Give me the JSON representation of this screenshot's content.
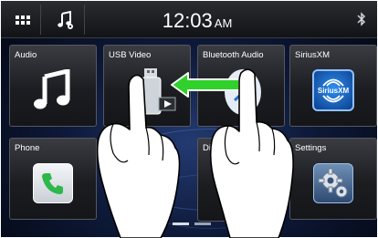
{
  "topbar": {
    "time": "12:03",
    "ampm": "AM"
  },
  "tiles": {
    "audio": "Audio",
    "usb_video": "USB Video",
    "bluetooth_audio": "Bluetooth Audio",
    "siriusxm": "SiriusXM",
    "phone": "Phone",
    "direct_partial": "Di O",
    "settings": "Settings"
  },
  "siriusxm_logo_text": "SiriusXM",
  "icons": {
    "topbar": [
      "grid-menu-icon",
      "music-note-icon",
      "bluetooth-icon"
    ],
    "tiles": [
      "music-note-icon",
      "usb-drive-icon",
      "bluetooth-icon",
      "siriusxm-logo-icon",
      "phone-handset-icon",
      "gear-icon"
    ],
    "overlay": [
      "swipe-left-arrow",
      "left-hand",
      "right-hand"
    ]
  },
  "colors": {
    "accent_green": "#2fd12a",
    "siriusxm_blue": "#1a6fd6",
    "phone_green": "#2db84a"
  }
}
